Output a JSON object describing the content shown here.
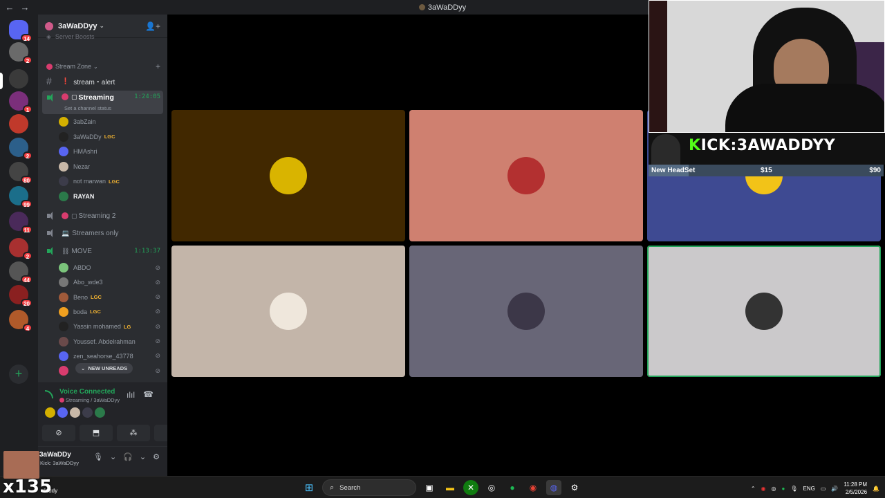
{
  "window": {
    "title": "3aWaDDyy"
  },
  "server": {
    "name": "3aWaDDyy",
    "faded_item": "Server Boosts"
  },
  "rail": {
    "servers": [
      {
        "name": "home",
        "badge": "14",
        "color": "#5865f2"
      },
      {
        "name": "s1",
        "badge": "2",
        "color": "#6a6a6a"
      },
      {
        "name": "s2",
        "badge": "",
        "color": "#3a3a3a"
      },
      {
        "name": "s3",
        "badge": "1",
        "color": "#7b2f7b"
      },
      {
        "name": "s4",
        "badge": "",
        "color": "#c0392b"
      },
      {
        "name": "s5",
        "badge": "2",
        "color": "#2c5f8a"
      },
      {
        "name": "s6",
        "badge": "80",
        "color": "#444"
      },
      {
        "name": "s7",
        "badge": "99",
        "color": "#1b6e8a"
      },
      {
        "name": "s8",
        "badge": "11",
        "color": "#4a2a5a"
      },
      {
        "name": "s9",
        "badge": "2",
        "color": "#a83030"
      },
      {
        "name": "s10",
        "badge": "44",
        "color": "#555"
      },
      {
        "name": "s11",
        "badge": "20",
        "color": "#8a2020"
      },
      {
        "name": "s12",
        "badge": "4",
        "color": "#b05a2a"
      }
    ]
  },
  "channels": {
    "category": "Stream Zone",
    "text_channel": "stream・alert",
    "streaming": {
      "name": "Streaming",
      "timer": "1:24:05",
      "subtitle": "Set a channel status"
    },
    "streaming_users": [
      {
        "name": "3abZain",
        "lgc": "",
        "color": "#d4b000",
        "bright": false
      },
      {
        "name": "3aWaDDy",
        "lgc": "LGC",
        "color": "#222",
        "bright": false
      },
      {
        "name": "HMAshri",
        "lgc": "",
        "color": "#5865f2",
        "bright": false
      },
      {
        "name": "Nezar",
        "lgc": "",
        "color": "#c8b8a8",
        "bright": false
      },
      {
        "name": "not marwan",
        "lgc": "LGC",
        "color": "#3c3c4a",
        "bright": false
      },
      {
        "name": "RAYAN",
        "lgc": "",
        "color": "#2b7a4a",
        "bright": true
      }
    ],
    "streaming2": "Streaming 2",
    "streamers_only": "Streamers only",
    "move": {
      "name": "MOVE",
      "timer": "1:13:37"
    },
    "move_users": [
      {
        "name": "ABDO",
        "lgc": "",
        "color": "#7bc47b"
      },
      {
        "name": "Abo_wde3",
        "lgc": "",
        "color": "#777"
      },
      {
        "name": "Beno",
        "lgc": "LGC",
        "color": "#a05a3a"
      },
      {
        "name": "boda",
        "lgc": "LGC",
        "color": "#f0a020"
      },
      {
        "name": "Yassin mohamed",
        "lgc": "LG",
        "color": "#222"
      },
      {
        "name": "Youssef. Abdelrahman",
        "lgc": "",
        "color": "#6a4a4a"
      },
      {
        "name": "zen_seahorse_43778",
        "lgc": "",
        "color": "#5865f2"
      }
    ],
    "new_unreads": "NEW UNREADS"
  },
  "voice_panel": {
    "title": "Voice Connected",
    "subtitle": "Streaming / 3aWaDDyy",
    "avatars": [
      "#d4b000",
      "#5865f2",
      "#c8b8a8",
      "#3c3c4a",
      "#2b7a4a"
    ]
  },
  "user_panel": {
    "name": "3aWaDDy",
    "status": "Kick: 3aWaDDyy"
  },
  "tiles": [
    {
      "name": "tile-1",
      "bg": "#412800",
      "face": "#d9b400",
      "speaking": false
    },
    {
      "name": "tile-2",
      "bg": "#cf8070",
      "face": "#b33030",
      "speaking": false
    },
    {
      "name": "tile-3",
      "bg": "#3e4a92",
      "face": "#f2c318",
      "speaking": false
    },
    {
      "name": "tile-4",
      "bg": "#c3b5a9",
      "face": "#efe7dc",
      "speaking": false
    },
    {
      "name": "tile-5",
      "bg": "#686677",
      "face": "#3c3748",
      "speaking": false
    },
    {
      "name": "tile-6",
      "bg": "#cbc9cb",
      "face": "#333333",
      "speaking": true
    }
  ],
  "overlay": {
    "kick_prefix": "K",
    "kick_text": "ICK:3AWADDYY",
    "goal_label": "New HeadSet",
    "goal_current": "$15",
    "goal_target": "$90",
    "goal_fraction": 0.17
  },
  "taskbar": {
    "x_count": "x135",
    "weather": "cloudy",
    "search": "Search",
    "lang": "ENG",
    "time": "11:28 PM",
    "date": "2/5/2026"
  }
}
